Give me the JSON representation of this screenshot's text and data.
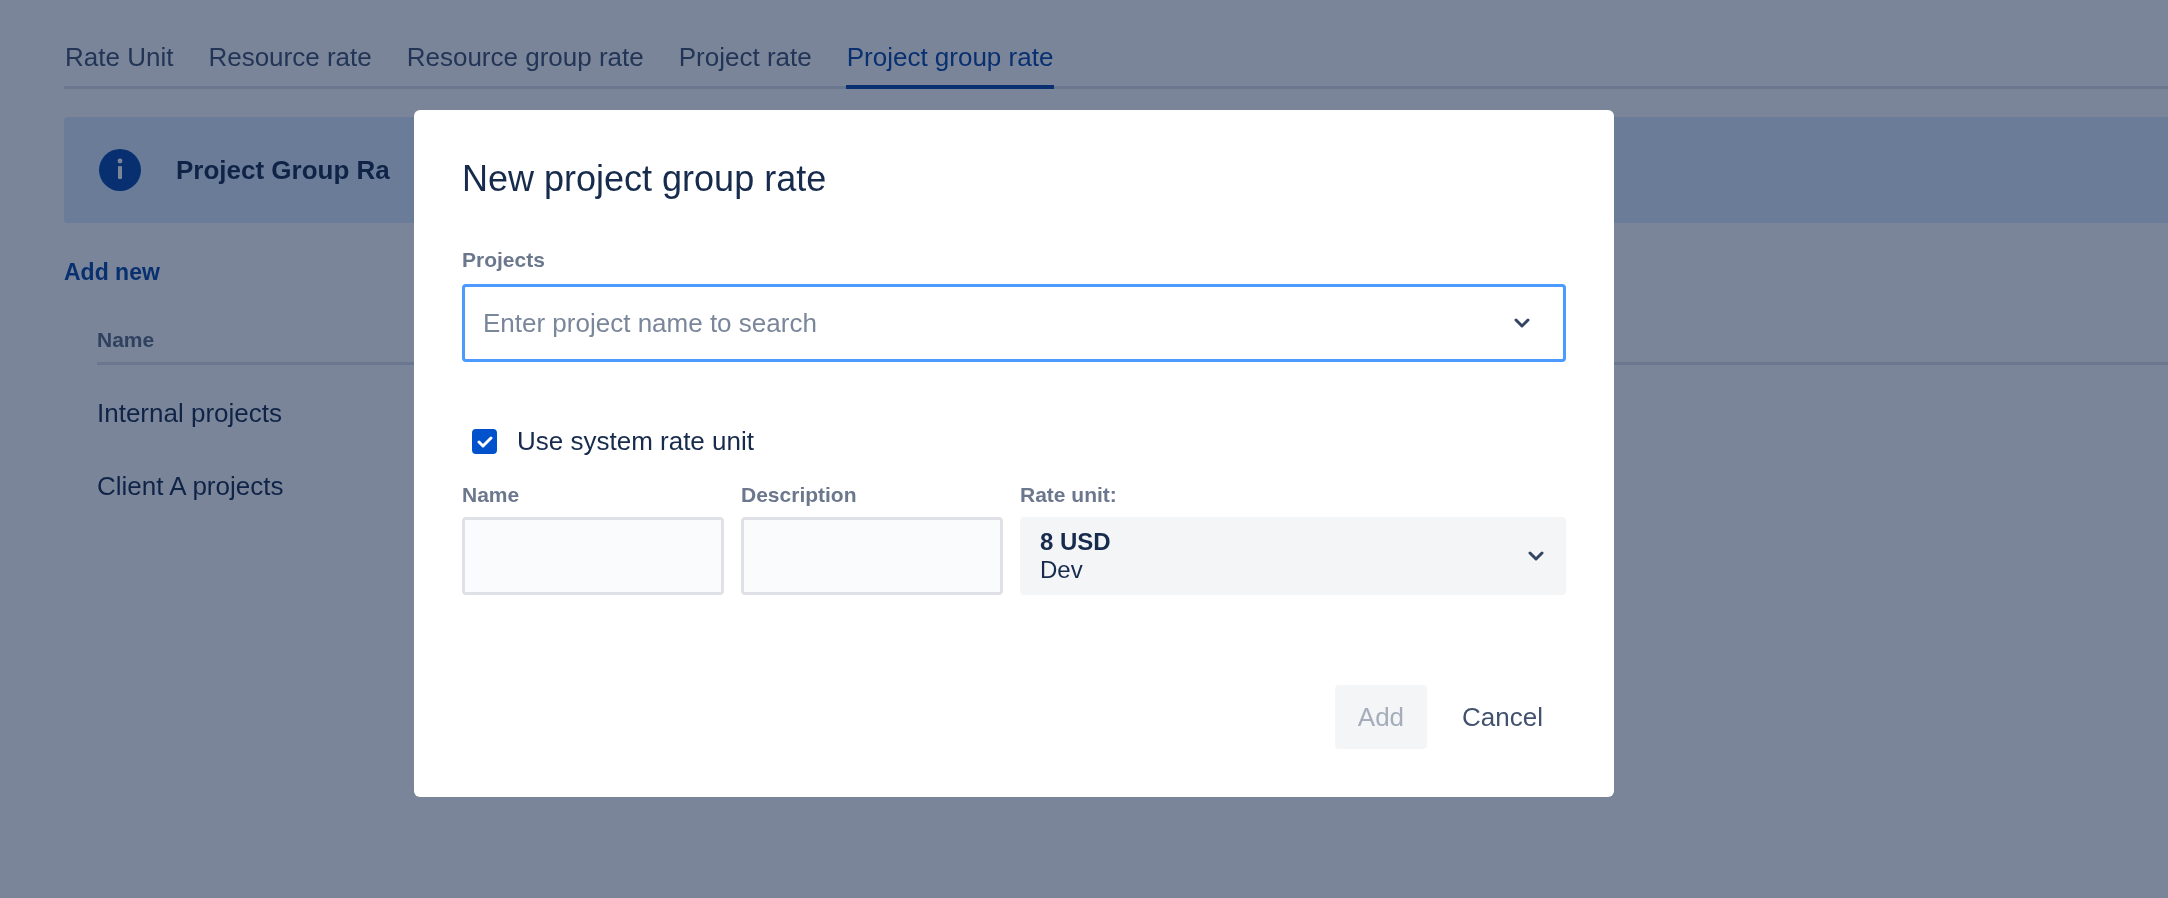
{
  "tabs": [
    {
      "label": "Rate Unit",
      "selected": false
    },
    {
      "label": "Resource rate",
      "selected": false
    },
    {
      "label": "Resource group rate",
      "selected": false
    },
    {
      "label": "Project rate",
      "selected": false
    },
    {
      "label": "Project group rate",
      "selected": true
    }
  ],
  "banner": {
    "title": "Project Group Ra"
  },
  "add_new": "Add new",
  "table": {
    "columns": [
      "Name"
    ],
    "rows": [
      {
        "name": "Internal projects"
      },
      {
        "name": "Client A projects"
      }
    ]
  },
  "dialog": {
    "title": "New project group rate",
    "projects_field": {
      "label": "Projects",
      "placeholder": "Enter project name to search"
    },
    "use_system_rate_unit": {
      "label": "Use system rate unit",
      "checked": true
    },
    "fields": [
      {
        "kind": "text",
        "label": "Name"
      },
      {
        "kind": "text",
        "label": "Description"
      },
      {
        "kind": "select",
        "label": "Rate unit:",
        "value": "8 USD",
        "detail": "Dev"
      }
    ],
    "buttons": [
      {
        "label": "Add",
        "disabled": true
      },
      {
        "label": "Cancel",
        "disabled": false
      }
    ]
  }
}
